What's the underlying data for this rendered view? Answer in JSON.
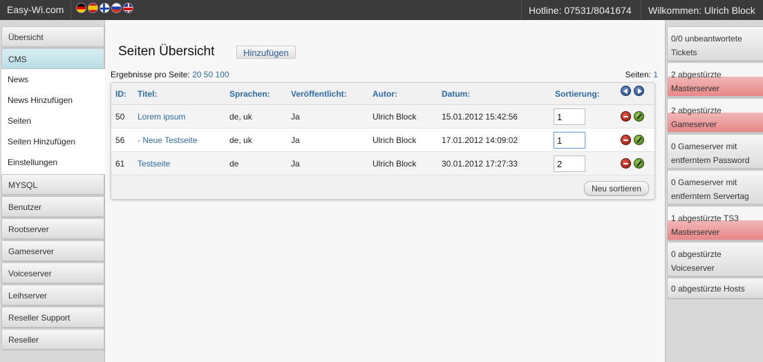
{
  "topbar": {
    "brand": "Easy-Wi.com",
    "flags": [
      "flag-de",
      "flag-es",
      "flag-fi",
      "flag-ru",
      "flag-uk"
    ],
    "hotline": "Hotline: 07531/8041674",
    "welcome": "Wilkommen: Ulrich Block"
  },
  "sidebar": {
    "items": [
      {
        "label": "Übersicht"
      },
      {
        "label": "CMS"
      },
      {
        "label": "MYSQL"
      },
      {
        "label": "Benutzer"
      },
      {
        "label": "Rootserver"
      },
      {
        "label": "Gameserver"
      },
      {
        "label": "Voiceserver"
      },
      {
        "label": "Leihserver"
      },
      {
        "label": "Reseller Support"
      },
      {
        "label": "Reseller"
      }
    ],
    "cms_sub": [
      "News",
      "News Hinzufügen",
      "Seiten",
      "Seiten Hinzufügen",
      "Einstellungen"
    ]
  },
  "main": {
    "title": "Seiten Übersicht",
    "add_label": "Hinzufügen",
    "per_page_label": "Ergebnisse pro Seite:",
    "per_page_options": [
      "20",
      "50",
      "100"
    ],
    "pages_label": "Seiten:",
    "pages": [
      "1"
    ],
    "columns": {
      "id": "ID:",
      "title": "Titel:",
      "languages": "Sprachen:",
      "published": "Veröffentlicht:",
      "author": "Autor:",
      "date": "Datum:",
      "sort": "Sortierung:"
    },
    "rows": [
      {
        "id": "50",
        "title": "Lorem ipsum",
        "languages": "de, uk",
        "published": "Ja",
        "author": "Ulrich Block",
        "date": "15.01.2012 15:42:56",
        "sort": "1"
      },
      {
        "id": "56",
        "title": "- Neue Testseite",
        "languages": "de, uk",
        "published": "Ja",
        "author": "Ulrich Block",
        "date": "17.01.2012 14:09:02",
        "sort": "1"
      },
      {
        "id": "61",
        "title": "Testseite",
        "languages": "de",
        "published": "Ja",
        "author": "Ulrich Block",
        "date": "30.01.2012 17:27:33",
        "sort": "2"
      }
    ],
    "resort_label": "Neu sortieren"
  },
  "status": [
    {
      "line1": "0/0 unbeantwortete",
      "line2": "Tickets",
      "alert": false
    },
    {
      "line1": "2 abgestürzte",
      "line2": "Masterserver",
      "alert": true
    },
    {
      "line1": "2 abgestürzte",
      "line2": "Gameserver",
      "alert": true
    },
    {
      "line1": "0 Gameserver mit",
      "line2": "entferntem Password",
      "alert": false
    },
    {
      "line1": "0 Gameserver mit",
      "line2": "entferntem Servertag",
      "alert": false
    },
    {
      "line1": "1 abgestürzte TS3",
      "line2": "Masterserver",
      "alert": true
    },
    {
      "line1": "0 abgestürzte",
      "line2": "Voiceserver",
      "alert": false
    },
    {
      "line1": "0 abgestürzte Hosts",
      "line2": "",
      "alert": false
    }
  ],
  "colors": {
    "topbar": "#3a3a3a",
    "link": "#2d6aa6",
    "active_nav": "#b9dde6",
    "alert": "#e88787"
  }
}
